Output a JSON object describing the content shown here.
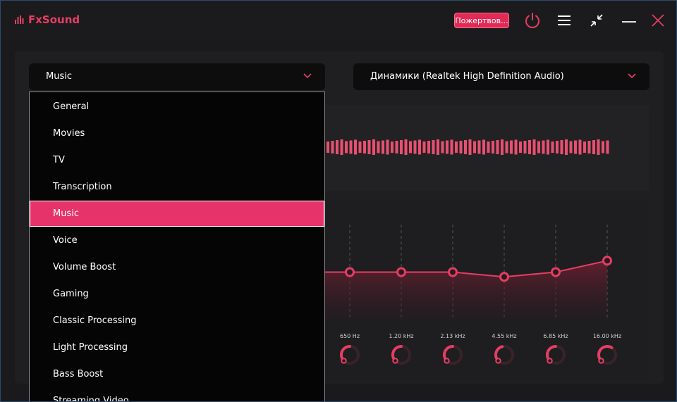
{
  "app": {
    "name": "FxSound",
    "accent": "#e63d63"
  },
  "titlebar": {
    "donate_label": "Пожертвов...",
    "icons": [
      "power-icon",
      "menu-icon",
      "minimize-view-icon",
      "minimize-icon",
      "close-icon"
    ]
  },
  "preset_select": {
    "value": "Music"
  },
  "output_select": {
    "value": "Динамики (Realtek High Definition Audio)"
  },
  "preset_menu": {
    "items": [
      "General",
      "Movies",
      "TV",
      "Transcription",
      "Music",
      "Voice",
      "Volume Boost",
      "Gaming",
      "Classic Processing",
      "Light Processing",
      "Bass Boost",
      "Streaming Video"
    ],
    "selected": "Music"
  },
  "equalizer": {
    "bands": [
      {
        "label": "650 Hz",
        "level": 0.5
      },
      {
        "label": "1.20 kHz",
        "level": 0.5
      },
      {
        "label": "2.13 kHz",
        "level": 0.5
      },
      {
        "label": "4.55 kHz",
        "level": 0.45
      },
      {
        "label": "6.85 kHz",
        "level": 0.5
      },
      {
        "label": "16.00 kHz",
        "level": 0.62
      }
    ]
  }
}
